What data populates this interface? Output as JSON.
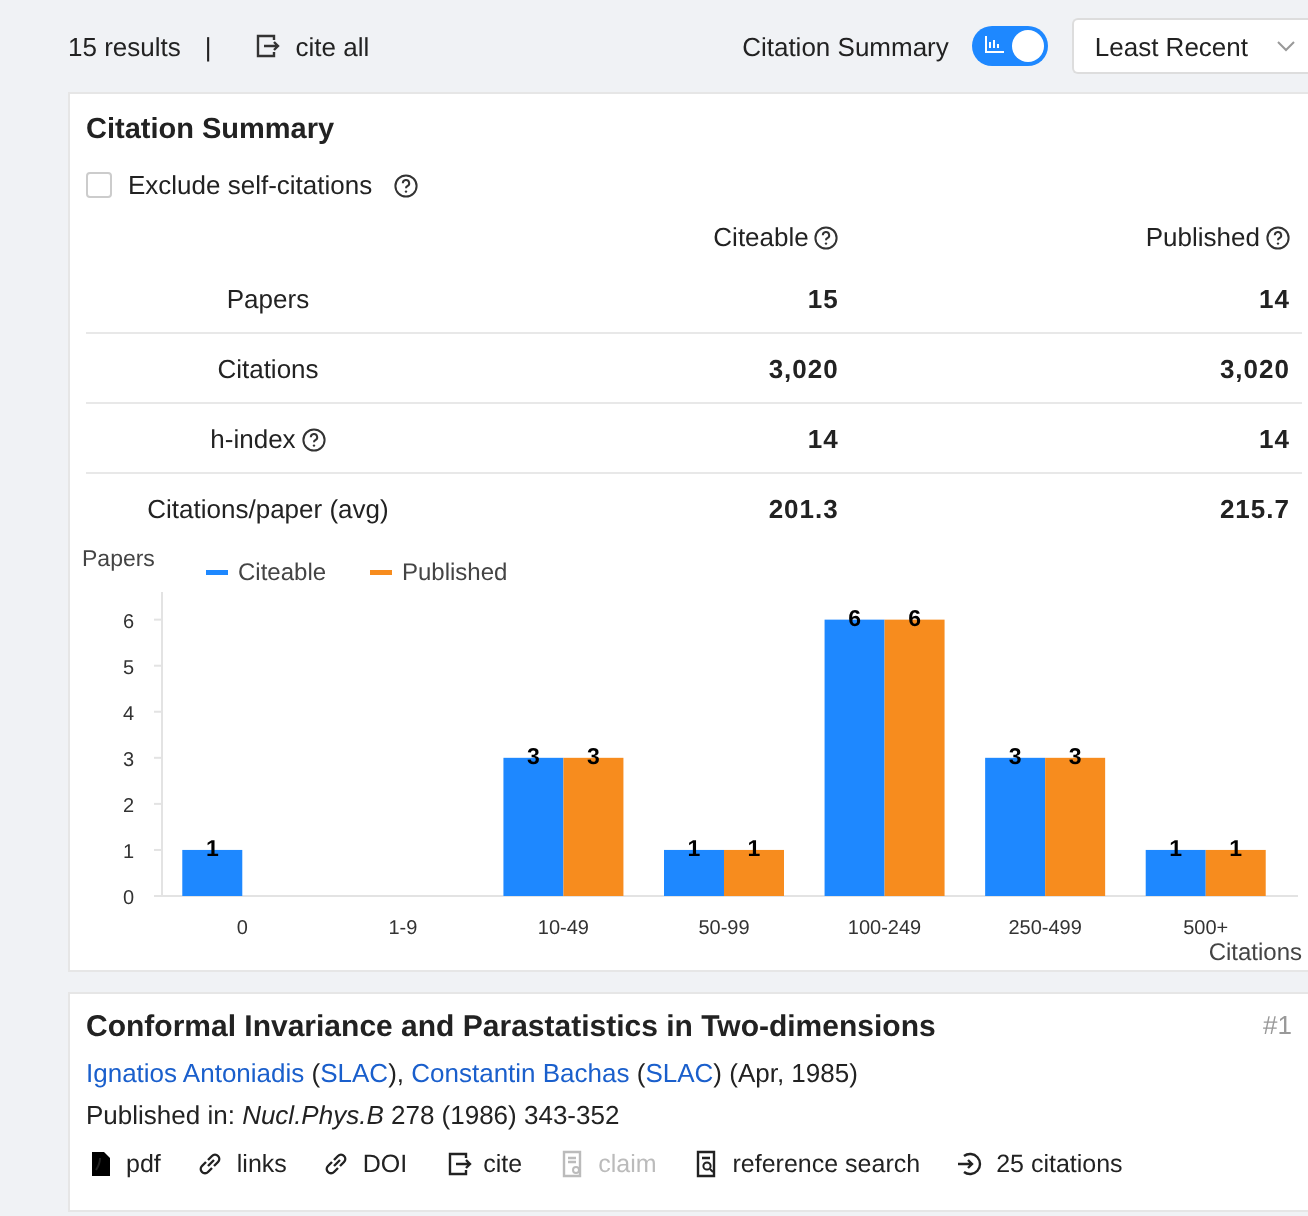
{
  "toolbar": {
    "results": "15 results",
    "separator": "|",
    "cite_all": "cite all",
    "summary_label": "Citation Summary",
    "summary_toggle": {
      "on": true
    },
    "sort": "Least Recent"
  },
  "summary": {
    "title": "Citation Summary",
    "exclude_self": {
      "label": "Exclude self-citations",
      "checked": false
    },
    "columns": [
      "Citeable",
      "Published"
    ],
    "rows": [
      {
        "label": "Papers",
        "help": false,
        "values": [
          "15",
          "14"
        ]
      },
      {
        "label": "Citations",
        "help": false,
        "values": [
          "3,020",
          "3,020"
        ]
      },
      {
        "label": "h-index",
        "help": true,
        "values": [
          "14",
          "14"
        ]
      },
      {
        "label": "Citations/paper (avg)",
        "help": false,
        "values": [
          "201.3",
          "215.7"
        ]
      }
    ],
    "chart_data": {
      "type": "bar",
      "xlabel": "Citations",
      "ylabel": "Papers",
      "categories": [
        "0",
        "1-9",
        "10-49",
        "50-99",
        "100-249",
        "250-499",
        "500+"
      ],
      "ylim": [
        0,
        6.6
      ],
      "legend": true,
      "yticks": [
        0,
        1,
        2,
        3,
        4,
        5,
        6
      ],
      "data_labels": true,
      "series": [
        {
          "name": "Citeable",
          "color": "#1e88ff",
          "values": [
            1,
            null,
            3,
            1,
            6,
            3,
            1
          ]
        },
        {
          "name": "Published",
          "color": "#f78c1e",
          "values": [
            null,
            null,
            3,
            1,
            6,
            3,
            1
          ]
        }
      ]
    }
  },
  "result": {
    "title": "Conformal Invariance and Parastatistics in Two-dimensions",
    "rank": "#1",
    "author_line": [
      {
        "kind": "link",
        "text": "Ignatios Antoniadis"
      },
      {
        "kind": "text",
        "text": " ("
      },
      {
        "kind": "link",
        "text": "SLAC"
      },
      {
        "kind": "text",
        "text": "), "
      },
      {
        "kind": "link",
        "text": "Constantin Bachas"
      },
      {
        "kind": "text",
        "text": " ("
      },
      {
        "kind": "link",
        "text": "SLAC"
      },
      {
        "kind": "text",
        "text": ") (Apr, 1985)"
      }
    ],
    "published": "Published in: *Nucl.Phys.B* 278 (1986) 343-352",
    "actions": [
      {
        "kind": "pdf",
        "label": "pdf",
        "disabled": false
      },
      {
        "kind": "link",
        "label": "links",
        "disabled": false
      },
      {
        "kind": "link",
        "label": "DOI",
        "disabled": false
      },
      {
        "kind": "cite",
        "label": "cite",
        "disabled": false
      },
      {
        "kind": "claim",
        "label": "claim",
        "disabled": true
      },
      {
        "kind": "search",
        "label": "reference search",
        "disabled": false
      },
      {
        "kind": "citations",
        "label": "25 citations",
        "disabled": false
      }
    ]
  }
}
